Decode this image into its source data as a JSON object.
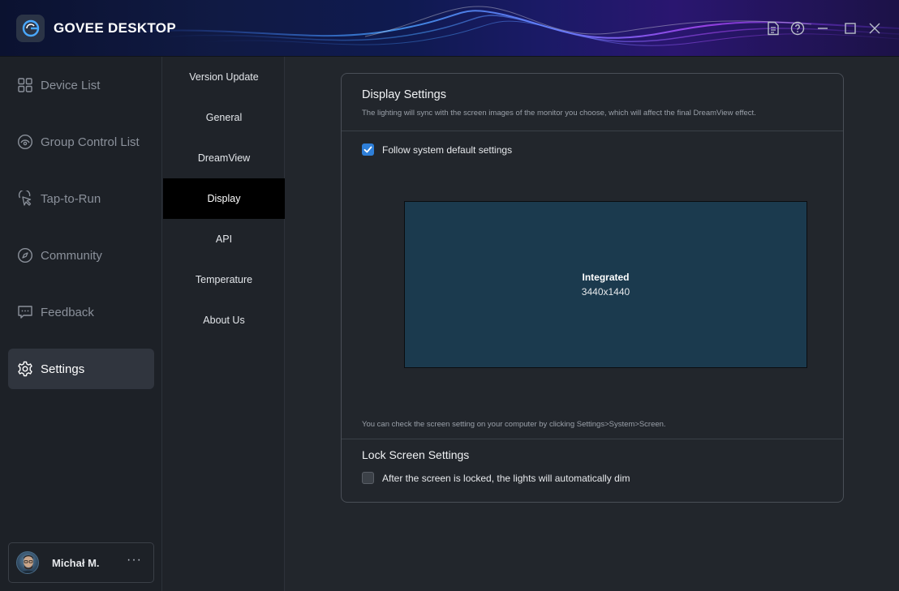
{
  "app": {
    "title": "GOVEE DESKTOP"
  },
  "window_controls": [
    {
      "name": "document-icon"
    },
    {
      "name": "help-icon"
    },
    {
      "name": "minimize-icon"
    },
    {
      "name": "maximize-icon"
    },
    {
      "name": "close-icon"
    }
  ],
  "sidebar": {
    "items": [
      {
        "label": "Device List",
        "icon": "grid-icon",
        "active": false
      },
      {
        "label": "Group Control List",
        "icon": "group-icon",
        "active": false
      },
      {
        "label": "Tap-to-Run",
        "icon": "tap-icon",
        "active": false
      },
      {
        "label": "Community",
        "icon": "compass-icon",
        "active": false
      },
      {
        "label": "Feedback",
        "icon": "feedback-icon",
        "active": false
      },
      {
        "label": "Settings",
        "icon": "gear-icon",
        "active": true
      }
    ],
    "user": {
      "name": "Michał M.",
      "more": "···"
    }
  },
  "subnav": {
    "items": [
      {
        "label": "Version Update",
        "active": false
      },
      {
        "label": "General",
        "active": false
      },
      {
        "label": "DreamView",
        "active": false
      },
      {
        "label": "Display",
        "active": true
      },
      {
        "label": "API",
        "active": false
      },
      {
        "label": "Temperature",
        "active": false
      },
      {
        "label": "About Us",
        "active": false
      }
    ]
  },
  "display_settings": {
    "title": "Display Settings",
    "description": "The lighting will sync with the screen images of the monitor you choose, which will affect the final DreamView effect.",
    "follow_default": {
      "label": "Follow system default settings",
      "checked": true
    },
    "monitor": {
      "name": "Integrated",
      "resolution": "3440x1440"
    },
    "hint": "You can check the screen setting on your computer by clicking Settings>System>Screen."
  },
  "lock_screen": {
    "title": "Lock Screen Settings",
    "auto_dim": {
      "label": "After the screen is locked, the lights will automatically dim",
      "checked": false
    }
  },
  "colors": {
    "accent": "#2e7fd9",
    "monitor_fill": "#1b3a4e",
    "active_subnav": "#000000"
  }
}
